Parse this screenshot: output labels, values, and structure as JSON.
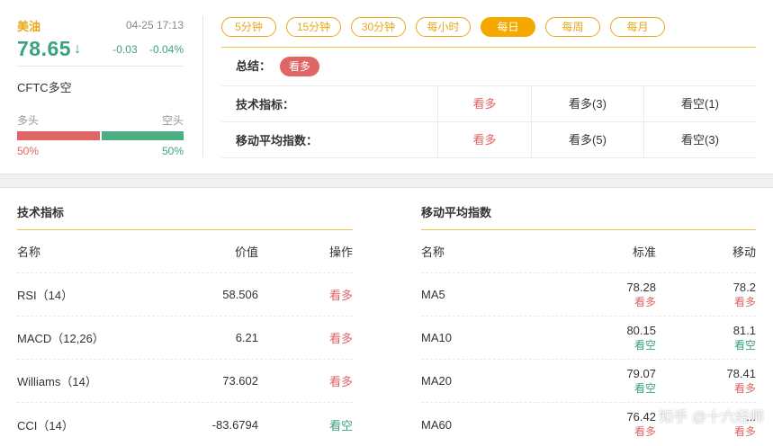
{
  "quote": {
    "name": "美油",
    "time": "04-25 17:13",
    "price": "78.65",
    "arrow": "↓",
    "change": "-0.03",
    "change_pct": "-0.04%",
    "cftc_label": "CFTC多空",
    "long_label": "多头",
    "short_label": "空头",
    "long_pct": "50%",
    "short_pct": "50%",
    "long_fraction": 0.5
  },
  "tabs": [
    "5分钟",
    "15分钟",
    "30分钟",
    "每小时",
    "每日",
    "每周",
    "每月"
  ],
  "active_tab": "每日",
  "summary": {
    "label": "总结：",
    "verdict": "看多",
    "rows": [
      {
        "label": "技术指标：",
        "signal": "看多",
        "bull": "看多(3)",
        "bear": "看空(1)"
      },
      {
        "label": "移动平均指数：",
        "signal": "看多",
        "bull": "看多(5)",
        "bear": "看空(3)"
      }
    ]
  },
  "tech": {
    "title": "技术指标",
    "headers": [
      "名称",
      "价值",
      "操作"
    ],
    "rows": [
      {
        "name": "RSI（14）",
        "value": "58.506",
        "action": "看多",
        "color": "red"
      },
      {
        "name": "MACD（12,26）",
        "value": "6.21",
        "action": "看多",
        "color": "red"
      },
      {
        "name": "Williams（14）",
        "value": "73.602",
        "action": "看多",
        "color": "red"
      },
      {
        "name": "CCI（14）",
        "value": "-83.6794",
        "action": "看空",
        "color": "green"
      }
    ]
  },
  "ma": {
    "title": "移动平均指数",
    "headers": [
      "名称",
      "标准",
      "移动"
    ],
    "rows": [
      {
        "name": "MA5",
        "std": "78.28",
        "std_sig": "看多",
        "std_color": "red",
        "mov": "78.2",
        "mov_sig": "看多",
        "mov_color": "red"
      },
      {
        "name": "MA10",
        "std": "80.15",
        "std_sig": "看空",
        "std_color": "green",
        "mov": "81.1",
        "mov_sig": "看空",
        "mov_color": "green"
      },
      {
        "name": "MA20",
        "std": "79.07",
        "std_sig": "看空",
        "std_color": "green",
        "mov": "78.41",
        "mov_sig": "看多",
        "mov_color": "red"
      },
      {
        "name": "MA60",
        "std": "76.42",
        "std_sig": "看多",
        "std_color": "red",
        "mov": "...",
        "mov_sig": "看多",
        "mov_color": "red"
      }
    ]
  },
  "watermark": "知乎 @十六经师"
}
